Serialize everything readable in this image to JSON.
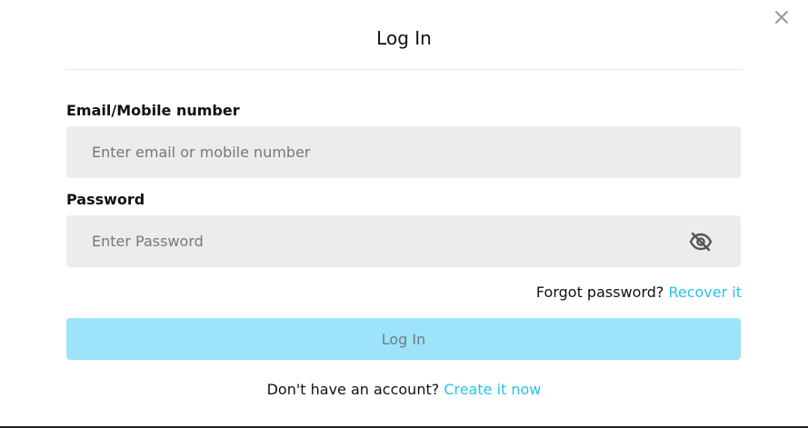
{
  "modal": {
    "title": "Log In",
    "close_icon": "close-icon"
  },
  "form": {
    "email": {
      "label": "Email/Mobile number",
      "placeholder": "Enter email or mobile number",
      "value": ""
    },
    "password": {
      "label": "Password",
      "placeholder": "Enter Password",
      "value": "",
      "toggle_icon": "eye-slash-icon"
    },
    "forgot": {
      "text": "Forgot password?",
      "link": "Recover it"
    },
    "submit_label": "Log In",
    "signup": {
      "text": "Don't have an account?",
      "link": "Create it now"
    }
  },
  "colors": {
    "accent": "#29c3ef",
    "button_bg": "#9de3f9",
    "input_bg": "#ececec"
  }
}
